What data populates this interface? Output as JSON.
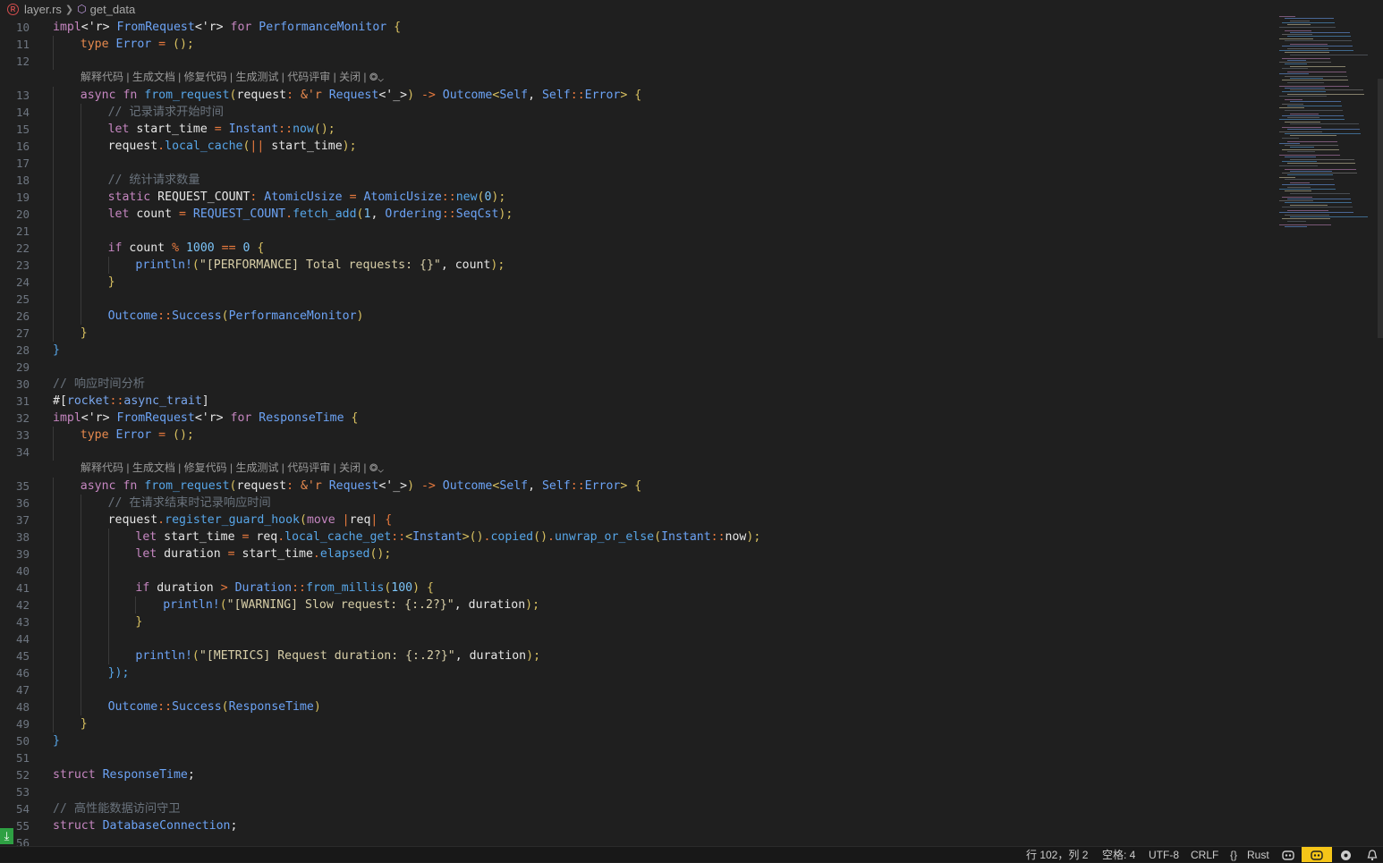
{
  "breadcrumb": {
    "file": "layer.rs",
    "symbol": "get_data"
  },
  "code_lens": {
    "items": [
      "解释代码",
      "生成文档",
      "修复代码",
      "生成测试",
      "代码评审",
      "关闭"
    ],
    "separator": " | "
  },
  "status_bar": {
    "position": "行 102，列 2",
    "indent": "空格: 4",
    "encoding": "UTF-8",
    "eol": "CRLF",
    "language": "Rust",
    "icons": [
      "braces-icon",
      "copilot-icon",
      "copilot-active-icon",
      "settings-icon",
      "bell-icon"
    ]
  },
  "colors": {
    "background": "#1f1f1f",
    "keyword": "#c586c0",
    "type": "#6ca3f5",
    "comment": "#6a737d",
    "status_accent": "#f5c518",
    "download_badge": "#2ea043"
  },
  "lines": [
    {
      "n": "10",
      "indent": 0,
      "t": [
        [
          "impl",
          "kw"
        ],
        [
          "<'r> ",
          "lt"
        ],
        [
          "FromRequest",
          "ty"
        ],
        [
          "<'r> ",
          "lt"
        ],
        [
          "for ",
          "kw"
        ],
        [
          "PerformanceMonitor",
          "ty"
        ],
        [
          " {",
          "pn"
        ]
      ]
    },
    {
      "n": "11",
      "indent": 1,
      "t": [
        [
          "type ",
          "kw2"
        ],
        [
          "Error",
          "ty"
        ],
        [
          " = ",
          "op"
        ],
        [
          "();",
          "pn"
        ]
      ]
    },
    {
      "n": "12",
      "indent": 1,
      "t": []
    },
    {
      "lens": true
    },
    {
      "n": "13",
      "indent": 1,
      "t": [
        [
          "async ",
          "kw"
        ],
        [
          "fn ",
          "kw"
        ],
        [
          "from_request",
          "fn"
        ],
        [
          "(",
          "pn"
        ],
        [
          "request",
          "id"
        ],
        [
          ": ",
          "op"
        ],
        [
          "&'r ",
          "kw2"
        ],
        [
          "Request",
          "ty"
        ],
        [
          "<'_>",
          "lt"
        ],
        [
          ")",
          "pn"
        ],
        [
          " -> ",
          "op"
        ],
        [
          "Outcome",
          "ty"
        ],
        [
          "<",
          "pn"
        ],
        [
          "Self",
          "ty"
        ],
        [
          ", ",
          "id"
        ],
        [
          "Self",
          "ty"
        ],
        [
          "::",
          "op"
        ],
        [
          "Error",
          "ty"
        ],
        [
          "> {",
          "pn"
        ]
      ]
    },
    {
      "n": "14",
      "indent": 2,
      "t": [
        [
          "// 记录请求开始时间",
          "cm"
        ]
      ]
    },
    {
      "n": "15",
      "indent": 2,
      "t": [
        [
          "let ",
          "kw"
        ],
        [
          "start_time",
          "id"
        ],
        [
          " = ",
          "op"
        ],
        [
          "Instant",
          "ty"
        ],
        [
          "::",
          "op"
        ],
        [
          "now",
          "fn"
        ],
        [
          "();",
          "pn"
        ]
      ]
    },
    {
      "n": "16",
      "indent": 2,
      "t": [
        [
          "request",
          "id"
        ],
        [
          ".",
          "op"
        ],
        [
          "local_cache",
          "fn"
        ],
        [
          "(",
          "pn"
        ],
        [
          "|| ",
          "op"
        ],
        [
          "start_time",
          "id"
        ],
        [
          ");",
          "pn"
        ]
      ]
    },
    {
      "n": "17",
      "indent": 2,
      "t": []
    },
    {
      "n": "18",
      "indent": 2,
      "t": [
        [
          "// 统计请求数量",
          "cm"
        ]
      ]
    },
    {
      "n": "19",
      "indent": 2,
      "t": [
        [
          "static ",
          "kw"
        ],
        [
          "REQUEST_COUNT",
          "id"
        ],
        [
          ": ",
          "op"
        ],
        [
          "AtomicUsize",
          "ty"
        ],
        [
          " = ",
          "op"
        ],
        [
          "AtomicUsize",
          "ty"
        ],
        [
          "::",
          "op"
        ],
        [
          "new",
          "fn"
        ],
        [
          "(",
          "pn"
        ],
        [
          "0",
          "num"
        ],
        [
          ");",
          "pn"
        ]
      ]
    },
    {
      "n": "20",
      "indent": 2,
      "t": [
        [
          "let ",
          "kw"
        ],
        [
          "count",
          "id"
        ],
        [
          " = ",
          "op"
        ],
        [
          "REQUEST_COUNT",
          "ty"
        ],
        [
          ".",
          "op"
        ],
        [
          "fetch_add",
          "fn"
        ],
        [
          "(",
          "pn"
        ],
        [
          "1",
          "num"
        ],
        [
          ", ",
          "id"
        ],
        [
          "Ordering",
          "ty"
        ],
        [
          "::",
          "op"
        ],
        [
          "SeqCst",
          "ty"
        ],
        [
          ");",
          "pn"
        ]
      ]
    },
    {
      "n": "21",
      "indent": 2,
      "t": []
    },
    {
      "n": "22",
      "indent": 2,
      "t": [
        [
          "if ",
          "kw"
        ],
        [
          "count",
          "id"
        ],
        [
          " % ",
          "op"
        ],
        [
          "1000",
          "num"
        ],
        [
          " == ",
          "op"
        ],
        [
          "0",
          "num"
        ],
        [
          " {",
          "pn"
        ]
      ]
    },
    {
      "n": "23",
      "indent": 3,
      "t": [
        [
          "println!",
          "mac"
        ],
        [
          "(",
          "pn"
        ],
        [
          "\"[PERFORMANCE] Total requests: {}\"",
          "str"
        ],
        [
          ", ",
          "id"
        ],
        [
          "count",
          "id"
        ],
        [
          ");",
          "pn"
        ]
      ]
    },
    {
      "n": "24",
      "indent": 2,
      "t": [
        [
          "}",
          "pn"
        ]
      ]
    },
    {
      "n": "25",
      "indent": 2,
      "t": []
    },
    {
      "n": "26",
      "indent": 2,
      "t": [
        [
          "Outcome",
          "ty"
        ],
        [
          "::",
          "op"
        ],
        [
          "Success",
          "ty"
        ],
        [
          "(",
          "pn"
        ],
        [
          "PerformanceMonitor",
          "ty"
        ],
        [
          ")",
          "pn"
        ]
      ]
    },
    {
      "n": "27",
      "indent": 1,
      "t": [
        [
          "}",
          "pn"
        ]
      ]
    },
    {
      "n": "28",
      "indent": 0,
      "t": [
        [
          "}",
          "fn"
        ]
      ]
    },
    {
      "n": "29",
      "indent": 0,
      "t": []
    },
    {
      "n": "30",
      "indent": 0,
      "t": [
        [
          "// 响应时间分析",
          "cm"
        ]
      ]
    },
    {
      "n": "31",
      "indent": 0,
      "t": [
        [
          "#[",
          "id"
        ],
        [
          "rocket",
          "attr"
        ],
        [
          "::",
          "op"
        ],
        [
          "async_trait",
          "attr"
        ],
        [
          "]",
          "id"
        ]
      ]
    },
    {
      "n": "32",
      "indent": 0,
      "t": [
        [
          "impl",
          "kw"
        ],
        [
          "<'r> ",
          "lt"
        ],
        [
          "FromRequest",
          "ty"
        ],
        [
          "<'r> ",
          "lt"
        ],
        [
          "for ",
          "kw"
        ],
        [
          "ResponseTime",
          "ty"
        ],
        [
          " {",
          "pn"
        ]
      ]
    },
    {
      "n": "33",
      "indent": 1,
      "t": [
        [
          "type ",
          "kw2"
        ],
        [
          "Error",
          "ty"
        ],
        [
          " = ",
          "op"
        ],
        [
          "();",
          "pn"
        ]
      ]
    },
    {
      "n": "34",
      "indent": 1,
      "t": []
    },
    {
      "lens": true
    },
    {
      "n": "35",
      "indent": 1,
      "t": [
        [
          "async ",
          "kw"
        ],
        [
          "fn ",
          "kw"
        ],
        [
          "from_request",
          "fn"
        ],
        [
          "(",
          "pn"
        ],
        [
          "request",
          "id"
        ],
        [
          ": ",
          "op"
        ],
        [
          "&'r ",
          "kw2"
        ],
        [
          "Request",
          "ty"
        ],
        [
          "<'_>",
          "lt"
        ],
        [
          ")",
          "pn"
        ],
        [
          " -> ",
          "op"
        ],
        [
          "Outcome",
          "ty"
        ],
        [
          "<",
          "pn"
        ],
        [
          "Self",
          "ty"
        ],
        [
          ", ",
          "id"
        ],
        [
          "Self",
          "ty"
        ],
        [
          "::",
          "op"
        ],
        [
          "Error",
          "ty"
        ],
        [
          "> {",
          "pn"
        ]
      ]
    },
    {
      "n": "36",
      "indent": 2,
      "t": [
        [
          "// 在请求结束时记录响应时间",
          "cm"
        ]
      ]
    },
    {
      "n": "37",
      "indent": 2,
      "t": [
        [
          "request",
          "id"
        ],
        [
          ".",
          "op"
        ],
        [
          "register_guard_hook",
          "fn"
        ],
        [
          "(",
          "pn"
        ],
        [
          "move ",
          "kw"
        ],
        [
          "|",
          "op"
        ],
        [
          "req",
          "id"
        ],
        [
          "| {",
          "op"
        ]
      ]
    },
    {
      "n": "38",
      "indent": 3,
      "t": [
        [
          "let ",
          "kw"
        ],
        [
          "start_time",
          "id"
        ],
        [
          " = ",
          "op"
        ],
        [
          "req",
          "id"
        ],
        [
          ".",
          "op"
        ],
        [
          "local_cache_get",
          "fn"
        ],
        [
          "::",
          "op"
        ],
        [
          "<",
          "pn"
        ],
        [
          "Instant",
          "ty"
        ],
        [
          ">",
          "pn"
        ],
        [
          "()",
          "pn"
        ],
        [
          ".",
          "op"
        ],
        [
          "copied",
          "fn"
        ],
        [
          "()",
          "pn"
        ],
        [
          ".",
          "op"
        ],
        [
          "unwrap_or_else",
          "fn"
        ],
        [
          "(",
          "pn"
        ],
        [
          "Instant",
          "ty"
        ],
        [
          "::",
          "op"
        ],
        [
          "now",
          "id"
        ],
        [
          ");",
          "pn"
        ]
      ]
    },
    {
      "n": "39",
      "indent": 3,
      "t": [
        [
          "let ",
          "kw"
        ],
        [
          "duration",
          "id"
        ],
        [
          " = ",
          "op"
        ],
        [
          "start_time",
          "id"
        ],
        [
          ".",
          "op"
        ],
        [
          "elapsed",
          "fn"
        ],
        [
          "();",
          "pn"
        ]
      ]
    },
    {
      "n": "40",
      "indent": 3,
      "t": []
    },
    {
      "n": "41",
      "indent": 3,
      "t": [
        [
          "if ",
          "kw"
        ],
        [
          "duration",
          "id"
        ],
        [
          " > ",
          "op"
        ],
        [
          "Duration",
          "ty"
        ],
        [
          "::",
          "op"
        ],
        [
          "from_millis",
          "fn"
        ],
        [
          "(",
          "pn"
        ],
        [
          "100",
          "num"
        ],
        [
          ") {",
          "pn"
        ]
      ]
    },
    {
      "n": "42",
      "indent": 4,
      "t": [
        [
          "println!",
          "mac"
        ],
        [
          "(",
          "pn"
        ],
        [
          "\"[WARNING] Slow request: {:.2?}\"",
          "str"
        ],
        [
          ", ",
          "id"
        ],
        [
          "duration",
          "id"
        ],
        [
          ");",
          "pn"
        ]
      ]
    },
    {
      "n": "43",
      "indent": 3,
      "t": [
        [
          "}",
          "pn"
        ]
      ]
    },
    {
      "n": "44",
      "indent": 3,
      "t": []
    },
    {
      "n": "45",
      "indent": 3,
      "t": [
        [
          "println!",
          "mac"
        ],
        [
          "(",
          "pn"
        ],
        [
          "\"[METRICS] Request duration: {:.2?}\"",
          "str"
        ],
        [
          ", ",
          "id"
        ],
        [
          "duration",
          "id"
        ],
        [
          ");",
          "pn"
        ]
      ]
    },
    {
      "n": "46",
      "indent": 2,
      "t": [
        [
          "});",
          "fn"
        ]
      ]
    },
    {
      "n": "47",
      "indent": 2,
      "t": []
    },
    {
      "n": "48",
      "indent": 2,
      "t": [
        [
          "Outcome",
          "ty"
        ],
        [
          "::",
          "op"
        ],
        [
          "Success",
          "ty"
        ],
        [
          "(",
          "pn"
        ],
        [
          "ResponseTime",
          "ty"
        ],
        [
          ")",
          "pn"
        ]
      ]
    },
    {
      "n": "49",
      "indent": 1,
      "t": [
        [
          "}",
          "pn"
        ]
      ]
    },
    {
      "n": "50",
      "indent": 0,
      "t": [
        [
          "}",
          "fn"
        ]
      ]
    },
    {
      "n": "51",
      "indent": 0,
      "t": []
    },
    {
      "n": "52",
      "indent": 0,
      "t": [
        [
          "struct ",
          "kw"
        ],
        [
          "ResponseTime",
          "ty"
        ],
        [
          ";",
          "id"
        ]
      ]
    },
    {
      "n": "53",
      "indent": 0,
      "t": []
    },
    {
      "n": "54",
      "indent": 0,
      "t": [
        [
          "// 高性能数据访问守卫",
          "cm"
        ]
      ]
    },
    {
      "n": "55",
      "indent": 0,
      "t": [
        [
          "struct ",
          "kw"
        ],
        [
          "DatabaseConnection",
          "ty"
        ],
        [
          ";",
          "id"
        ]
      ]
    },
    {
      "n": "56",
      "indent": 0,
      "t": []
    }
  ]
}
